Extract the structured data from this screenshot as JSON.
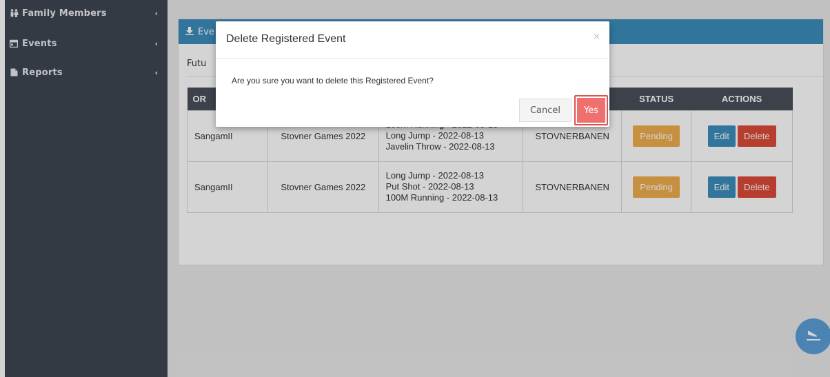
{
  "sidebar": {
    "items": [
      {
        "label": "Family Members",
        "icon": "family-icon",
        "chevron": "‹"
      },
      {
        "label": "Events",
        "icon": "calendar-icon",
        "chevron": "‹"
      },
      {
        "label": "Reports",
        "icon": "document-icon",
        "chevron": "‹"
      }
    ]
  },
  "card": {
    "header_label": "Eve",
    "subtitle": "Futu"
  },
  "table": {
    "headers": [
      "OR",
      "",
      "",
      "",
      "STATUS",
      "ACTIONS"
    ],
    "rows": [
      {
        "organizer": "SangamII",
        "event": "Stovner Games 2022",
        "activities": [
          "100M Running - 2022-08-13",
          "Long Jump - 2022-08-13",
          "Javelin Throw - 2022-08-13"
        ],
        "venue": "STOVNERBANEN",
        "status": "Pending",
        "edit": "Edit",
        "delete": "Delete"
      },
      {
        "organizer": "SangamII",
        "event": "Stovner Games 2022",
        "activities": [
          "Long Jump - 2022-08-13",
          "Put Shot - 2022-08-13",
          "100M Running - 2022-08-13"
        ],
        "venue": "STOVNERBANEN",
        "status": "Pending",
        "edit": "Edit",
        "delete": "Delete"
      }
    ]
  },
  "modal": {
    "title": "Delete Registered Event",
    "close": "×",
    "message": "Are you sure you want to delete this Registered Event?",
    "cancel_label": "Cancel",
    "confirm_label": "Yes"
  },
  "colors": {
    "sidebar_bg": "#3f4651",
    "header_blue": "#3c8dbc",
    "pending": "#f0ad4e",
    "delete_red": "#dd4b39",
    "yes_button": "#f07070"
  }
}
